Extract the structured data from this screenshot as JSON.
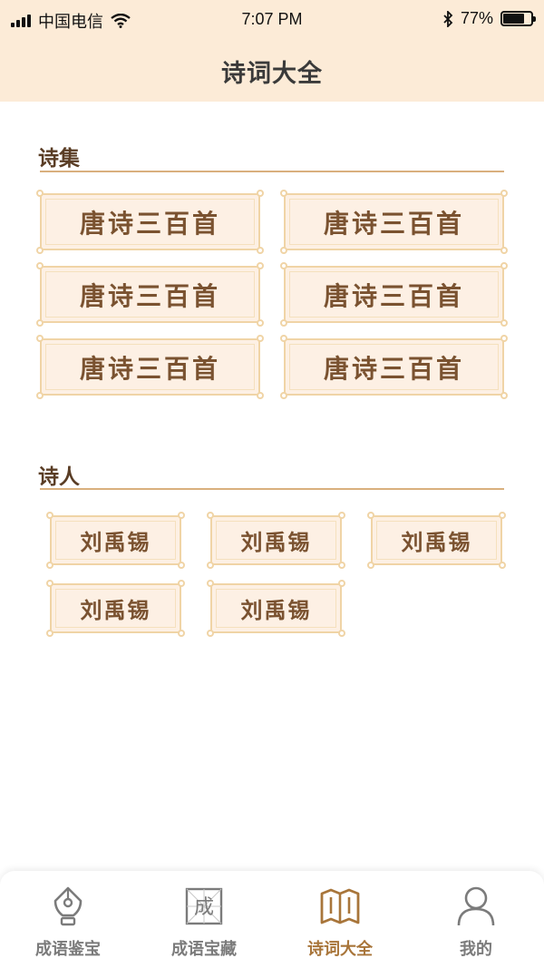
{
  "status_bar": {
    "carrier": "中国电信",
    "time": "7:07 PM",
    "battery_percent": "77%",
    "battery_level": 0.77
  },
  "header": {
    "title": "诗词大全"
  },
  "poem_collections": {
    "title": "诗集",
    "items": [
      "唐诗三百首",
      "唐诗三百首",
      "唐诗三百首",
      "唐诗三百首",
      "唐诗三百首",
      "唐诗三百首"
    ]
  },
  "poets": {
    "title": "诗人",
    "items": [
      "刘禹锡",
      "刘禹锡",
      "刘禹锡",
      "刘禹锡",
      "刘禹锡"
    ]
  },
  "tab_bar": {
    "items": [
      {
        "label": "成语鉴宝",
        "icon": "fountain-pen-icon",
        "active": false
      },
      {
        "label": "成语宝藏",
        "icon": "idiom-char-icon",
        "glyph": "成",
        "active": false
      },
      {
        "label": "诗词大全",
        "icon": "open-book-icon",
        "active": true
      },
      {
        "label": "我的",
        "icon": "user-icon",
        "active": false
      }
    ]
  },
  "colors": {
    "header_bg": "#fcebd7",
    "card_bg": "#fdf0e4",
    "card_border": "#f0d4a6",
    "card_text": "#7a5230",
    "section_line": "#d9b07e",
    "active_tab": "#a8753a",
    "inactive_tab": "#7b7b7b"
  }
}
